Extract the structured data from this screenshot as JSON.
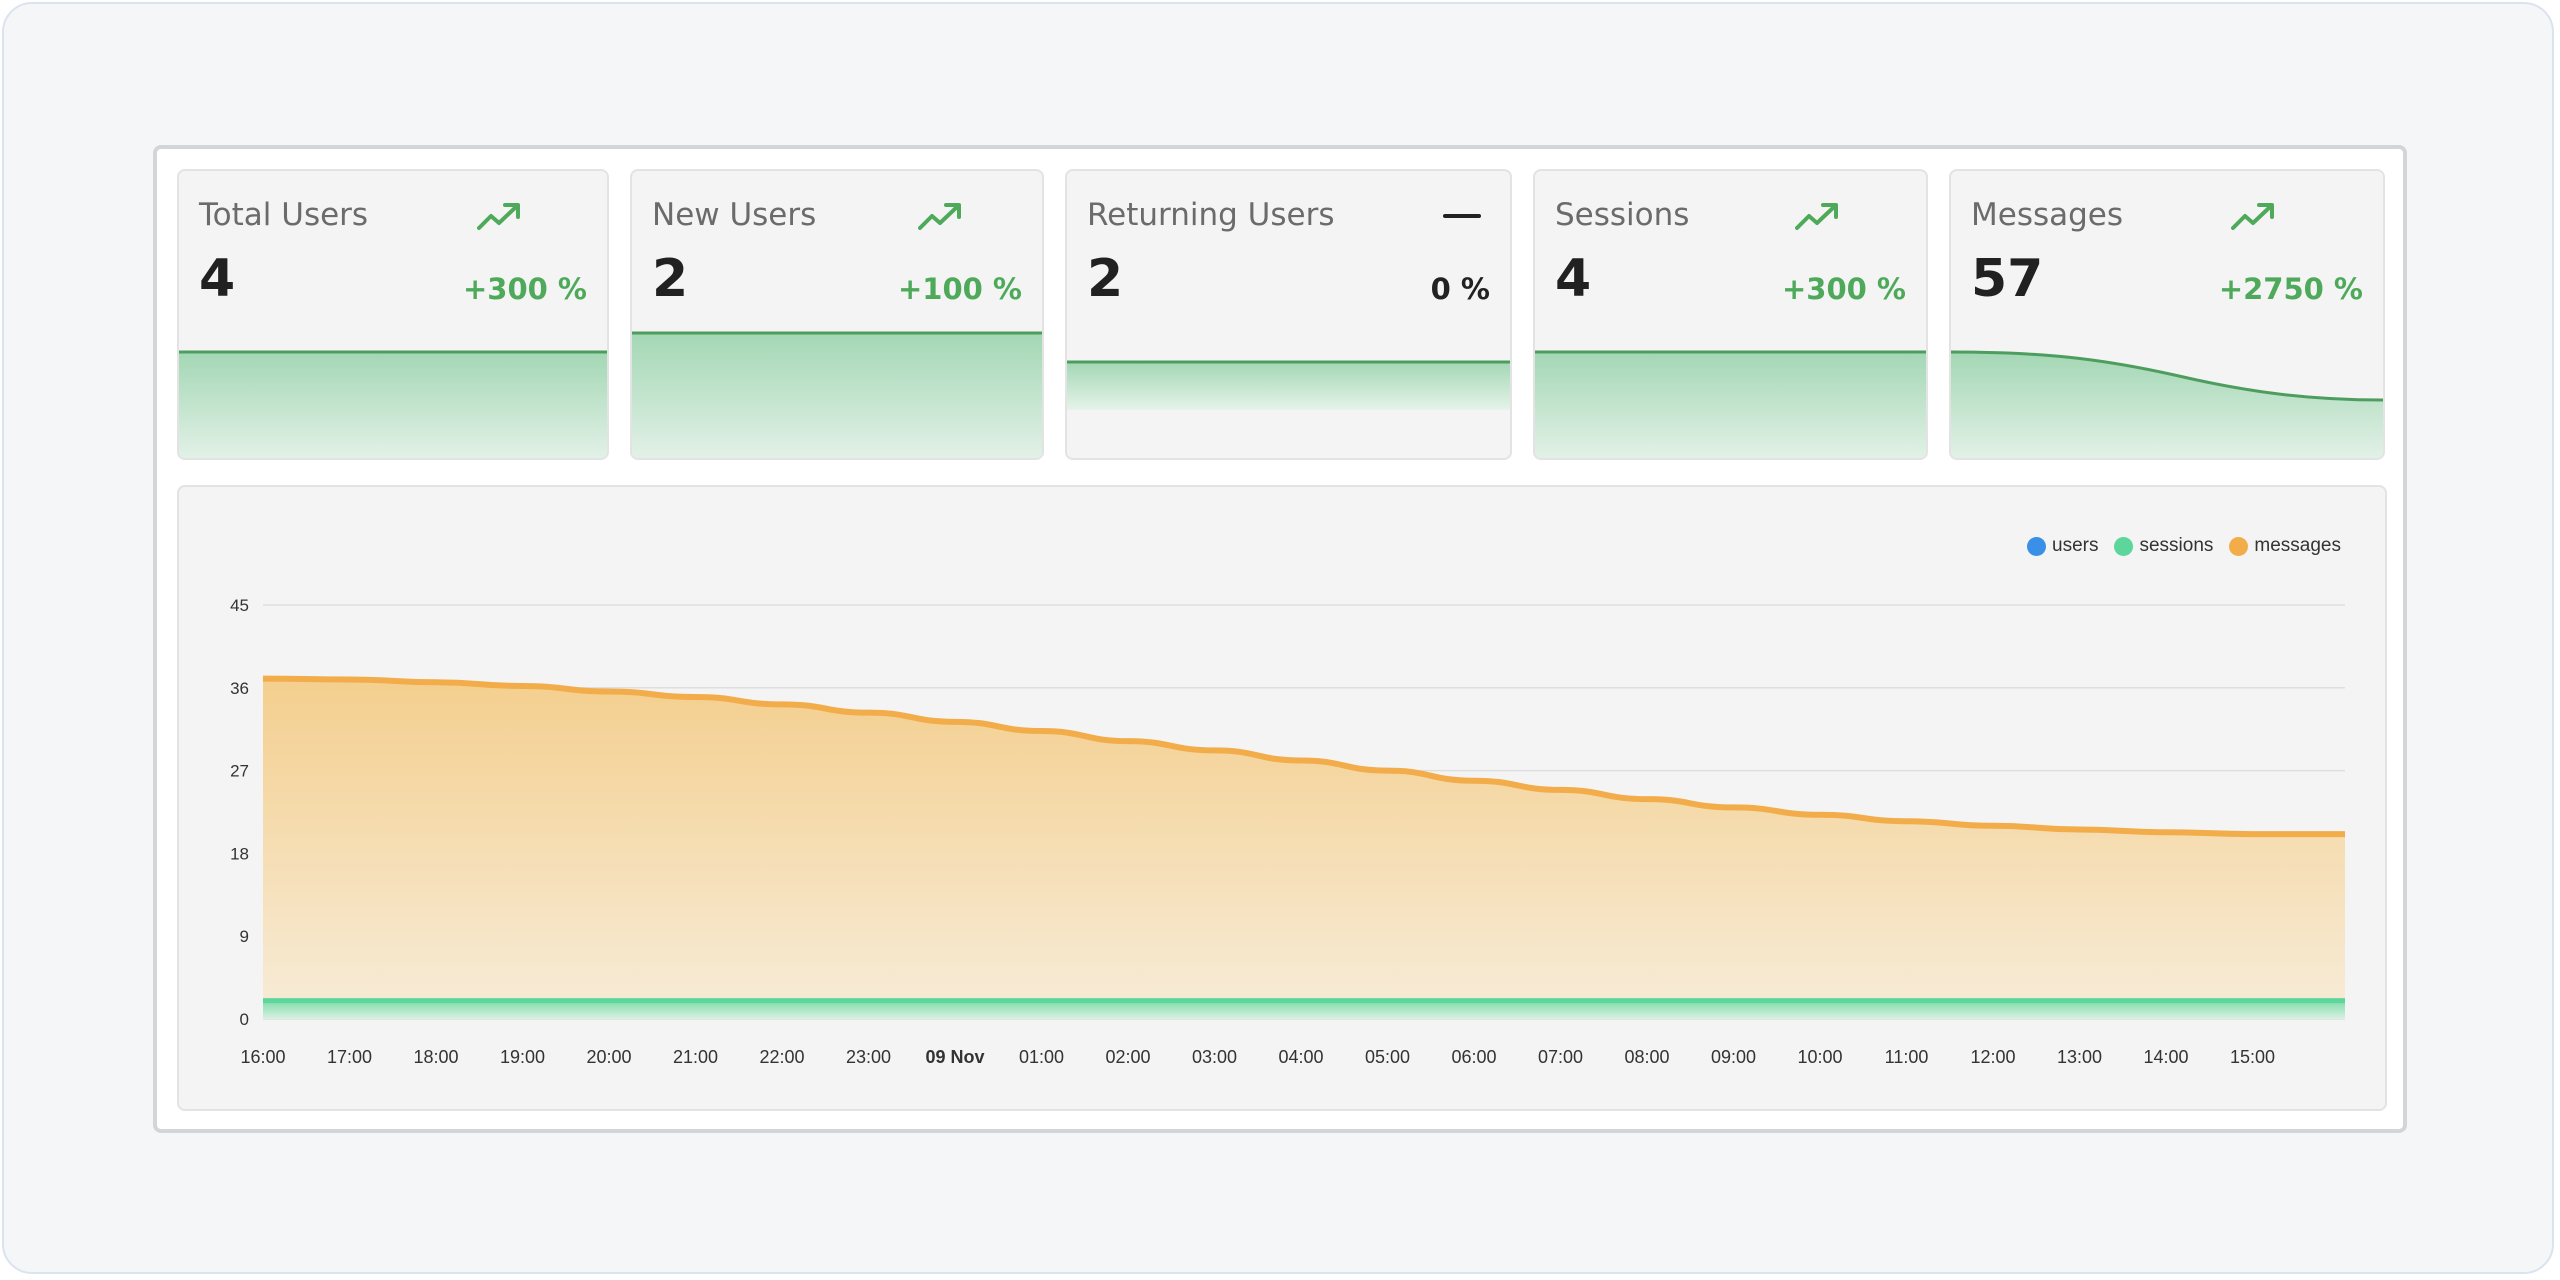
{
  "colors": {
    "accent_green": "#4eaa5a",
    "users": "#3a8fe6",
    "sessions": "#5cd69b",
    "messages": "#f2ad4a"
  },
  "cards": [
    {
      "title": "Total Users",
      "value": "4",
      "change": "+300 %",
      "trend_icon": "trending-up-icon",
      "spark": [
        1,
        1
      ]
    },
    {
      "title": "New Users",
      "value": "2",
      "change": "+100 %",
      "trend_icon": "trending-up-icon",
      "spark": [
        1,
        1
      ]
    },
    {
      "title": "Returning Users",
      "value": "2",
      "change": "0 %",
      "trend_icon": "flat-trend-icon",
      "spark": [
        1,
        1
      ]
    },
    {
      "title": "Sessions",
      "value": "4",
      "change": "+300 %",
      "trend_icon": "trending-up-icon",
      "spark": [
        1,
        1
      ]
    },
    {
      "title": "Messages",
      "value": "57",
      "change": "+2750 %",
      "trend_icon": "trending-up-icon",
      "spark": [
        37,
        20
      ]
    }
  ],
  "chart_data": {
    "type": "area",
    "x": [
      "16:00",
      "17:00",
      "18:00",
      "19:00",
      "20:00",
      "21:00",
      "22:00",
      "23:00",
      "09 Nov",
      "01:00",
      "02:00",
      "03:00",
      "04:00",
      "05:00",
      "06:00",
      "07:00",
      "08:00",
      "09:00",
      "10:00",
      "11:00",
      "12:00",
      "13:00",
      "14:00",
      "15:00"
    ],
    "x_bold": [
      "09 Nov"
    ],
    "yticks": [
      0,
      9,
      18,
      27,
      36,
      45
    ],
    "ylim": [
      0,
      45
    ],
    "grid": true,
    "legend_position": "top-right",
    "series": [
      {
        "name": "users",
        "color": "#3a8fe6",
        "values": [
          2,
          2,
          2,
          2,
          2,
          2,
          2,
          2,
          2,
          2,
          2,
          2,
          2,
          2,
          2,
          2,
          2,
          2,
          2,
          2,
          2,
          2,
          2,
          2
        ]
      },
      {
        "name": "sessions",
        "color": "#5cd69b",
        "values": [
          2,
          2,
          2,
          2,
          2,
          2,
          2,
          2,
          2,
          2,
          2,
          2,
          2,
          2,
          2,
          2,
          2,
          2,
          2,
          2,
          2,
          2,
          2,
          2
        ]
      },
      {
        "name": "messages",
        "color": "#f2ad4a",
        "values": [
          37,
          36.9,
          36.6,
          36.2,
          35.6,
          35,
          34.2,
          33.3,
          32.3,
          31.3,
          30.2,
          29.2,
          28.1,
          27,
          25.9,
          24.9,
          23.9,
          23,
          22.2,
          21.5,
          21,
          20.6,
          20.3,
          20.1
        ]
      }
    ]
  }
}
